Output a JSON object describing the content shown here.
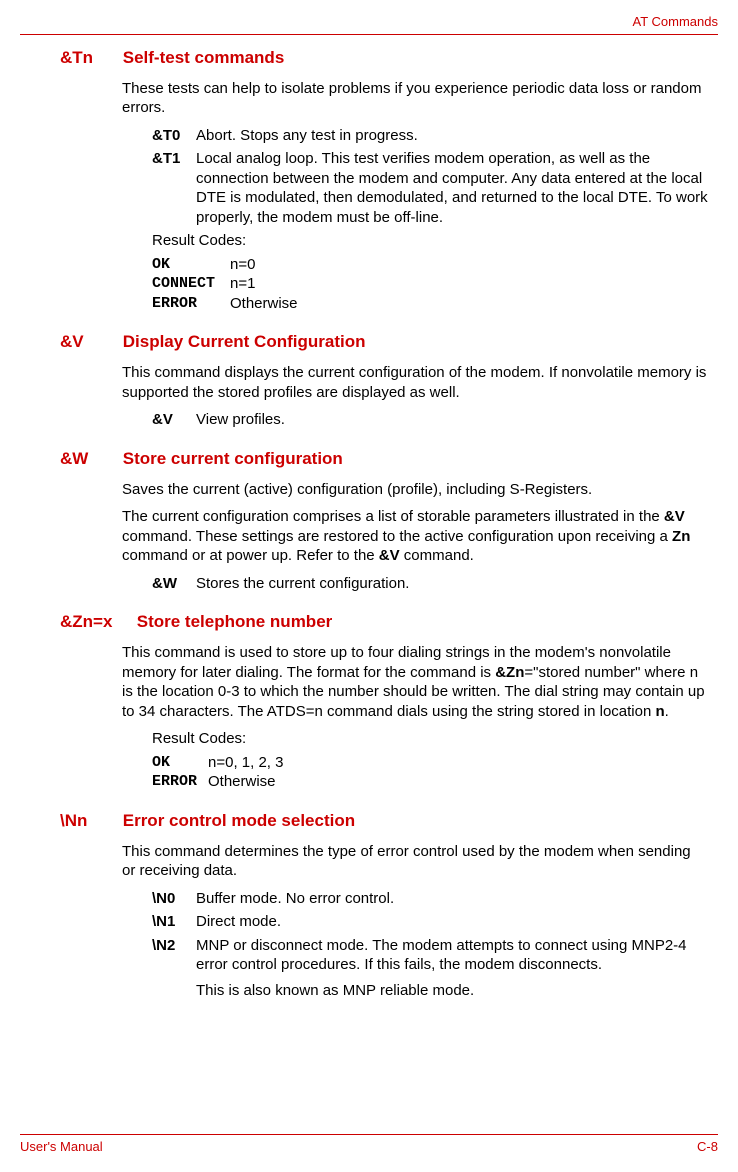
{
  "header": {
    "right": "AT Commands"
  },
  "footer": {
    "left": "User's Manual",
    "right": "C-8"
  },
  "sections": {
    "tn": {
      "code": "&Tn",
      "title": "Self-test commands",
      "intro": "These tests can help to isolate problems if you experience periodic data loss or random errors.",
      "params": [
        {
          "code": "&T0",
          "desc": "Abort. Stops any test in progress."
        },
        {
          "code": "&T1",
          "desc": "Local analog loop. This test verifies modem operation, as well as the connection between the modem and computer. Any data entered at the local DTE is modulated, then demodulated, and returned to the local DTE. To work properly, the modem must be off-line."
        }
      ],
      "result_label": "Result Codes:",
      "results": [
        {
          "code": "OK",
          "val": "n=0"
        },
        {
          "code": "CONNECT",
          "val": "n=1"
        },
        {
          "code": "ERROR",
          "val": "Otherwise"
        }
      ]
    },
    "v": {
      "code": "&V",
      "title": "Display Current Configuration",
      "intro": "This command displays the current configuration of the modem. If nonvolatile memory is supported the stored profiles are displayed as well.",
      "params": [
        {
          "code": "&V",
          "desc": "View profiles."
        }
      ]
    },
    "w": {
      "code": "&W",
      "title": "Store current configuration",
      "intro1": "Saves the current (active) configuration (profile), including S-Registers.",
      "intro2_pre": "The current configuration comprises a list of storable parameters illustrated in the ",
      "intro2_b1": "&V",
      "intro2_mid": " command. These settings are restored to the active configuration upon receiving a ",
      "intro2_b2": "Zn",
      "intro2_mid2": " command or at power up. Refer to the ",
      "intro2_b3": "&V",
      "intro2_post": " command.",
      "params": [
        {
          "code": "&W",
          "desc": "Stores the current configuration."
        }
      ]
    },
    "zn": {
      "code": "&Zn=x",
      "title": "Store telephone number",
      "intro_pre": "This command is used to store up to four dialing strings in the modem's nonvolatile memory for later dialing. The format for the command is ",
      "intro_b1": "&Zn",
      "intro_mid": "=\"stored number\" where n is the location 0-3 to which the number should be written. The dial string may contain up to 34 characters. The ATDS=n command dials using the string stored in location ",
      "intro_b2": "n",
      "intro_post": ".",
      "result_label": "Result Codes:",
      "results": [
        {
          "code": "OK",
          "val": "n=0, 1, 2, 3"
        },
        {
          "code": "ERROR",
          "val": "Otherwise"
        }
      ]
    },
    "nn": {
      "code": "\\Nn",
      "title": "Error control mode selection",
      "intro": "This command determines the type of error control used by the modem when sending or receiving data.",
      "params": [
        {
          "code": "\\N0",
          "desc": "Buffer mode. No error control."
        },
        {
          "code": "\\N1",
          "desc": "Direct mode."
        },
        {
          "code": "\\N2",
          "desc": "MNP or disconnect mode. The modem attempts to connect using MNP2-4 error control procedures. If this fails, the modem disconnects."
        }
      ],
      "extra": "This is also known as MNP reliable mode."
    }
  }
}
